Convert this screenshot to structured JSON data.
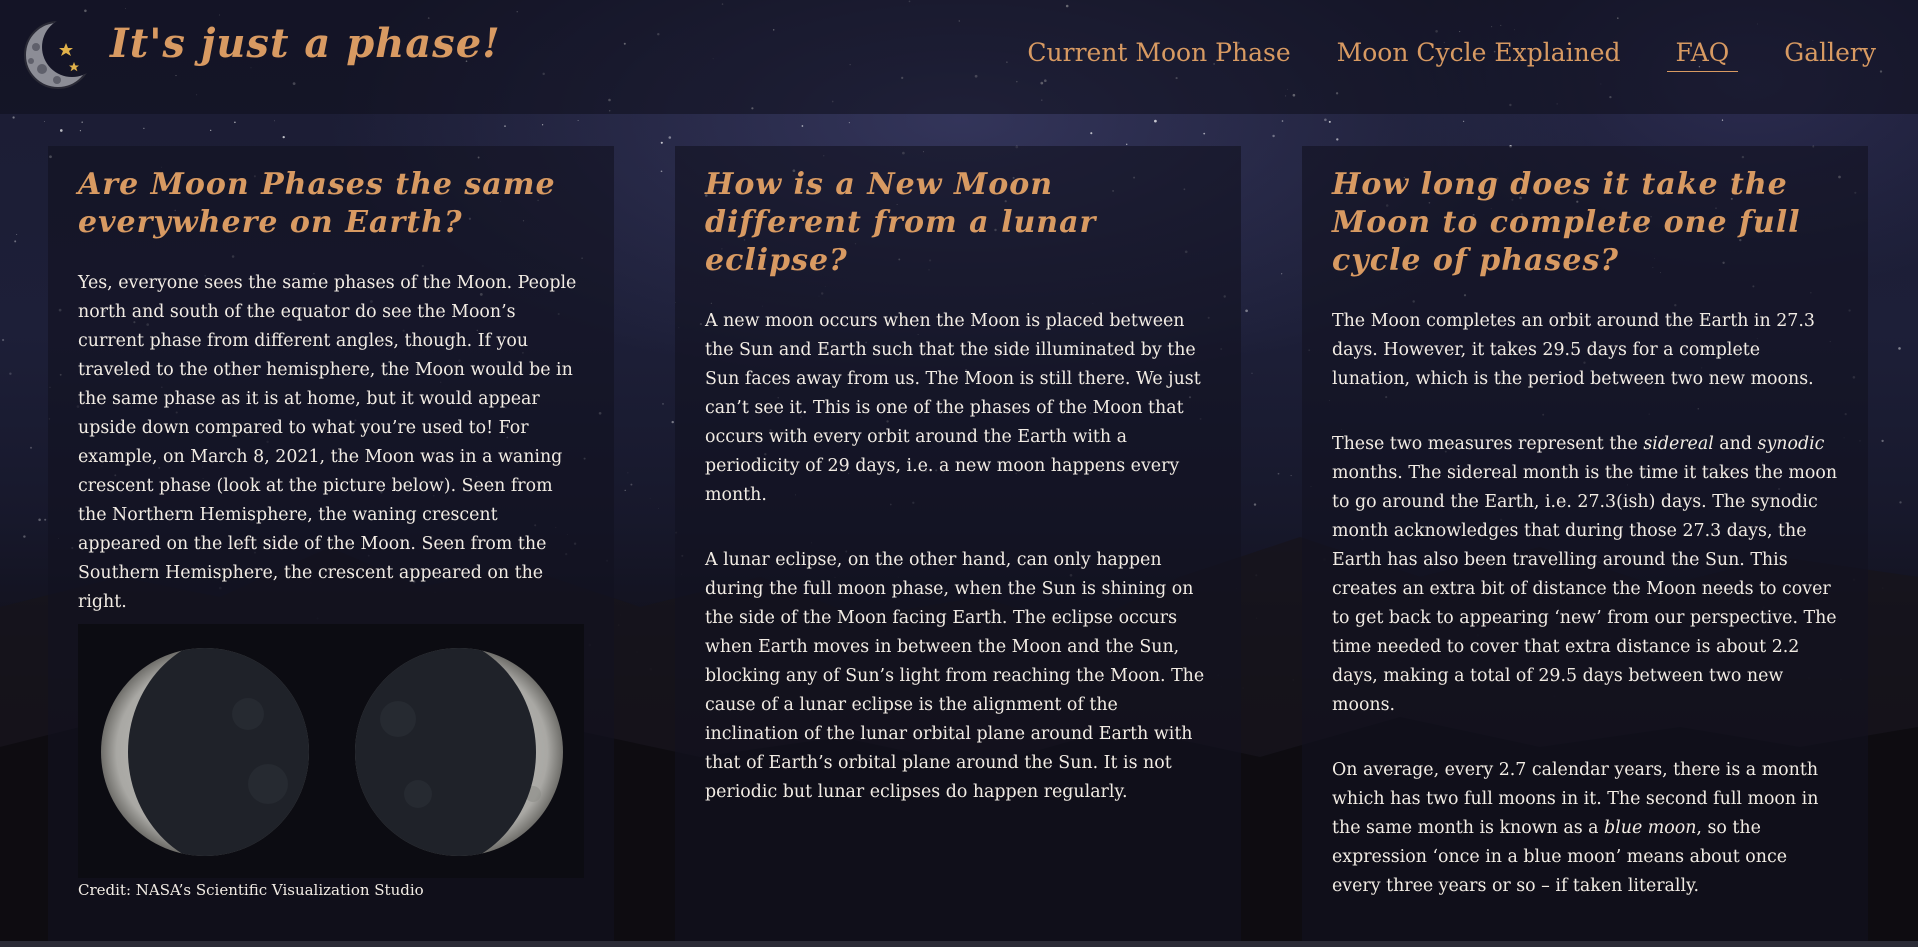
{
  "header": {
    "site_title": "It's just a phase!",
    "logo_icon": "crescent-moon-with-stars-icon",
    "nav": [
      {
        "label": "Current Moon Phase",
        "active": false
      },
      {
        "label": "Moon Cycle Explained",
        "active": false
      },
      {
        "label": "FAQ",
        "active": true
      },
      {
        "label": "Gallery",
        "active": false
      }
    ]
  },
  "colors": {
    "accent": "#d89a62",
    "text": "#f2ece4",
    "card_bg": "#121220"
  },
  "faq": [
    {
      "question": "Are Moon Phases the same everywhere on Earth?",
      "paragraphs": [
        "Yes, everyone sees the same phases of the Moon. People north and south of the equator do see the Moon’s current phase from different angles, though. If you traveled to the other hemisphere, the Moon would be in the same phase as it is at home, but it would appear upside down compared to what you’re used to! For example, on March 8, 2021, the Moon was in a waning crescent phase (look at the picture below). Seen from the Northern Hemisphere, the waning crescent appeared on the left side of the Moon. Seen from the Southern Hemisphere, the crescent appeared on the right."
      ],
      "image_credit": "Credit: NASA’s Scientific Visualization Studio"
    },
    {
      "question": "How is a New Moon different from a lunar eclipse?",
      "paragraphs": [
        "A new moon occurs when the Moon is placed between the Sun and Earth such that the side illuminated by the Sun faces away from us. The Moon is still there. We just can’t see it. This is one of the phases of the Moon that occurs with every orbit around the Earth with a periodicity of 29 days, i.e. a new moon happens every month.",
        "A lunar eclipse, on the other hand, can only happen during the full moon phase, when the Sun is shining on the side of the Moon facing Earth. The eclipse occurs when Earth moves in between the Moon and the Sun, blocking any of Sun’s light from reaching the Moon. The cause of a lunar eclipse is the alignment of the inclination of the lunar orbital plane around Earth with that of Earth’s orbital plane around the Sun. It is not periodic but lunar eclipses do happen regularly."
      ]
    },
    {
      "question": "How long does it take the Moon to complete one full cycle of phases?",
      "p1": "The Moon completes an orbit around the Earth in 27.3 days. However, it takes 29.5 days for a complete lunation, which is the period between two new moons.",
      "p2": {
        "before": "These two measures represent the ",
        "em1": "sidereal",
        "mid": " and ",
        "em2": "synodic",
        "after": " months. The sidereal month is the time it takes the moon to go around the Earth, i.e. 27.3(ish) days. The synodic month acknowledges that during those 27.3 days, the Earth has also been travelling around the Sun. This creates an extra bit of distance the Moon needs to cover to get back to appearing ‘new’ from our perspective. The time needed to cover that extra distance is about 2.2 days, making a total of 29.5 days between two new moons."
      },
      "p3": {
        "before": "On average, every 2.7 calendar years, there is a month which has two full moons in it. The second full moon in the same month is known as a ",
        "em": "blue moon",
        "after": ", so the expression ‘once in a blue moon’ means about once every three years or so – if taken literally."
      }
    }
  ]
}
